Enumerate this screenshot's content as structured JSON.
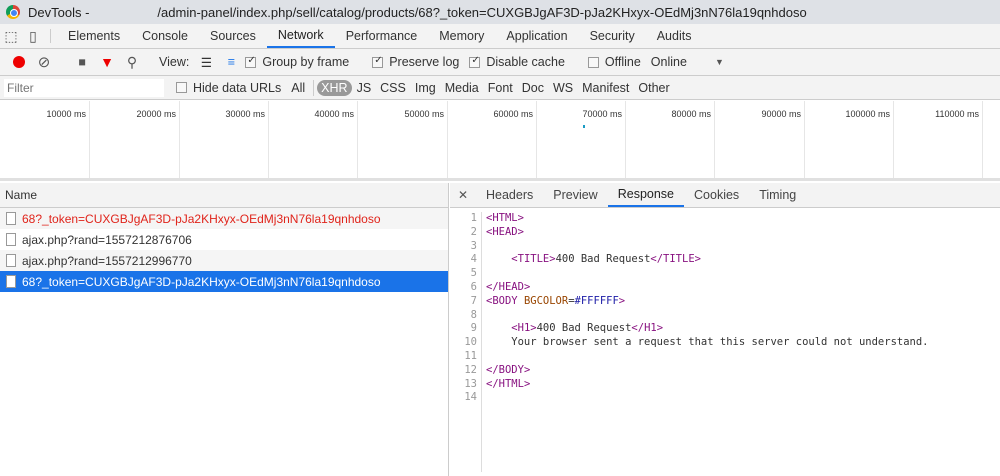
{
  "window": {
    "title": "DevTools -",
    "url": "/admin-panel/index.php/sell/catalog/products/68?_token=CUXGBJgAF3D-pJa2KHxyx-OEdMj3nN76la19qnhdoso"
  },
  "tabs": [
    "Elements",
    "Console",
    "Sources",
    "Network",
    "Performance",
    "Memory",
    "Application",
    "Security",
    "Audits"
  ],
  "toolbar": {
    "view_label": "View:",
    "group_by_frame": "Group by frame",
    "preserve_log": "Preserve log",
    "disable_cache": "Disable cache",
    "offline": "Offline",
    "throttle": "Online"
  },
  "filter": {
    "placeholder": "Filter",
    "hide_data_urls": "Hide data URLs",
    "types": [
      "All",
      "XHR",
      "JS",
      "CSS",
      "Img",
      "Media",
      "Font",
      "Doc",
      "WS",
      "Manifest",
      "Other"
    ]
  },
  "timeline": {
    "ticks": [
      "10000 ms",
      "20000 ms",
      "30000 ms",
      "40000 ms",
      "50000 ms",
      "60000 ms",
      "70000 ms",
      "80000 ms",
      "90000 ms",
      "100000 ms",
      "110000 ms"
    ]
  },
  "requests": {
    "header": "Name",
    "rows": [
      {
        "name": "68?_token=CUXGBJgAF3D-pJa2KHxyx-OEdMj3nN76la19qnhdoso",
        "status": "error"
      },
      {
        "name": "ajax.php?rand=1557212876706",
        "status": "normal"
      },
      {
        "name": "ajax.php?rand=1557212996770",
        "status": "normal"
      },
      {
        "name": "68?_token=CUXGBJgAF3D-pJa2KHxyx-OEdMj3nN76la19qnhdoso",
        "status": "selected"
      }
    ]
  },
  "detail": {
    "tabs": [
      "Headers",
      "Preview",
      "Response",
      "Cookies",
      "Timing"
    ],
    "lines": [
      "<HTML>",
      "<HEAD>",
      "",
      "    <TITLE>400 Bad Request</TITLE>",
      "",
      "</HEAD>",
      "<BODY BGCOLOR=#FFFFFF>",
      "",
      "    <H1>400 Bad Request</H1>",
      "    Your browser sent a request that this server could not understand.",
      "",
      "</BODY>",
      "</HTML>",
      ""
    ]
  }
}
